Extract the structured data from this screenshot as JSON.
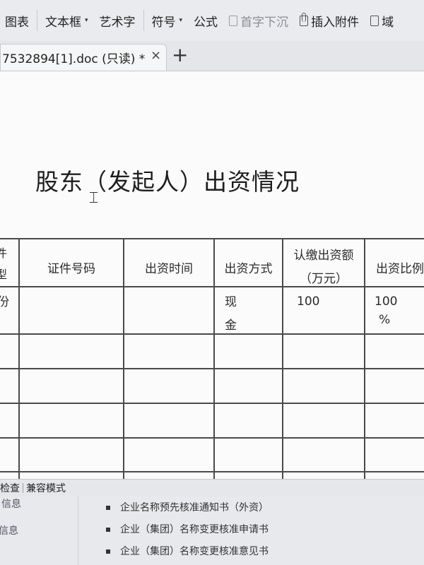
{
  "toolbar": {
    "items": [
      {
        "label": "图表",
        "dropdown": false
      },
      {
        "label": "文本框",
        "dropdown": true
      },
      {
        "label": "艺术字",
        "dropdown": false
      },
      {
        "label": "符号",
        "dropdown": true
      },
      {
        "label": "公式",
        "dropdown": false
      },
      {
        "label": "首字下沉",
        "icon": "drop-cap-icon",
        "disabled": true
      },
      {
        "label": "插入附件",
        "icon": "attachment-icon"
      },
      {
        "label": "域",
        "icon": "field-icon"
      }
    ],
    "caret": "▾"
  },
  "tabs": {
    "active_title": "7532894[1].doc (只读) *",
    "close_glyph": "×",
    "new_tab_glyph": "+"
  },
  "document": {
    "heading": "股东（发起人）出资情况",
    "table": {
      "headers": [
        {
          "line1": "件",
          "line2": "型"
        },
        {
          "line1": "证件号码"
        },
        {
          "line1": "出资时间"
        },
        {
          "line1": "出资方式"
        },
        {
          "line1": "认缴出资额",
          "line2": "（万元）"
        },
        {
          "line1": "出资比例"
        }
      ],
      "rows": [
        {
          "type": "份",
          "id_number": "",
          "time": "",
          "method_line1": "现",
          "method_line2": "金",
          "amount": "100",
          "ratio_line1": "100",
          "ratio_line2": "%"
        }
      ]
    }
  },
  "statusbar": {
    "items": [
      "检查",
      "兼容模式"
    ]
  },
  "background_page": {
    "left_items": [
      "信息",
      "信息"
    ],
    "list": [
      "企业名称预先核准通知书（外资）",
      "企业（集团）名称变更核准申请书",
      "企业（集团）名称变更核准意见书"
    ]
  }
}
